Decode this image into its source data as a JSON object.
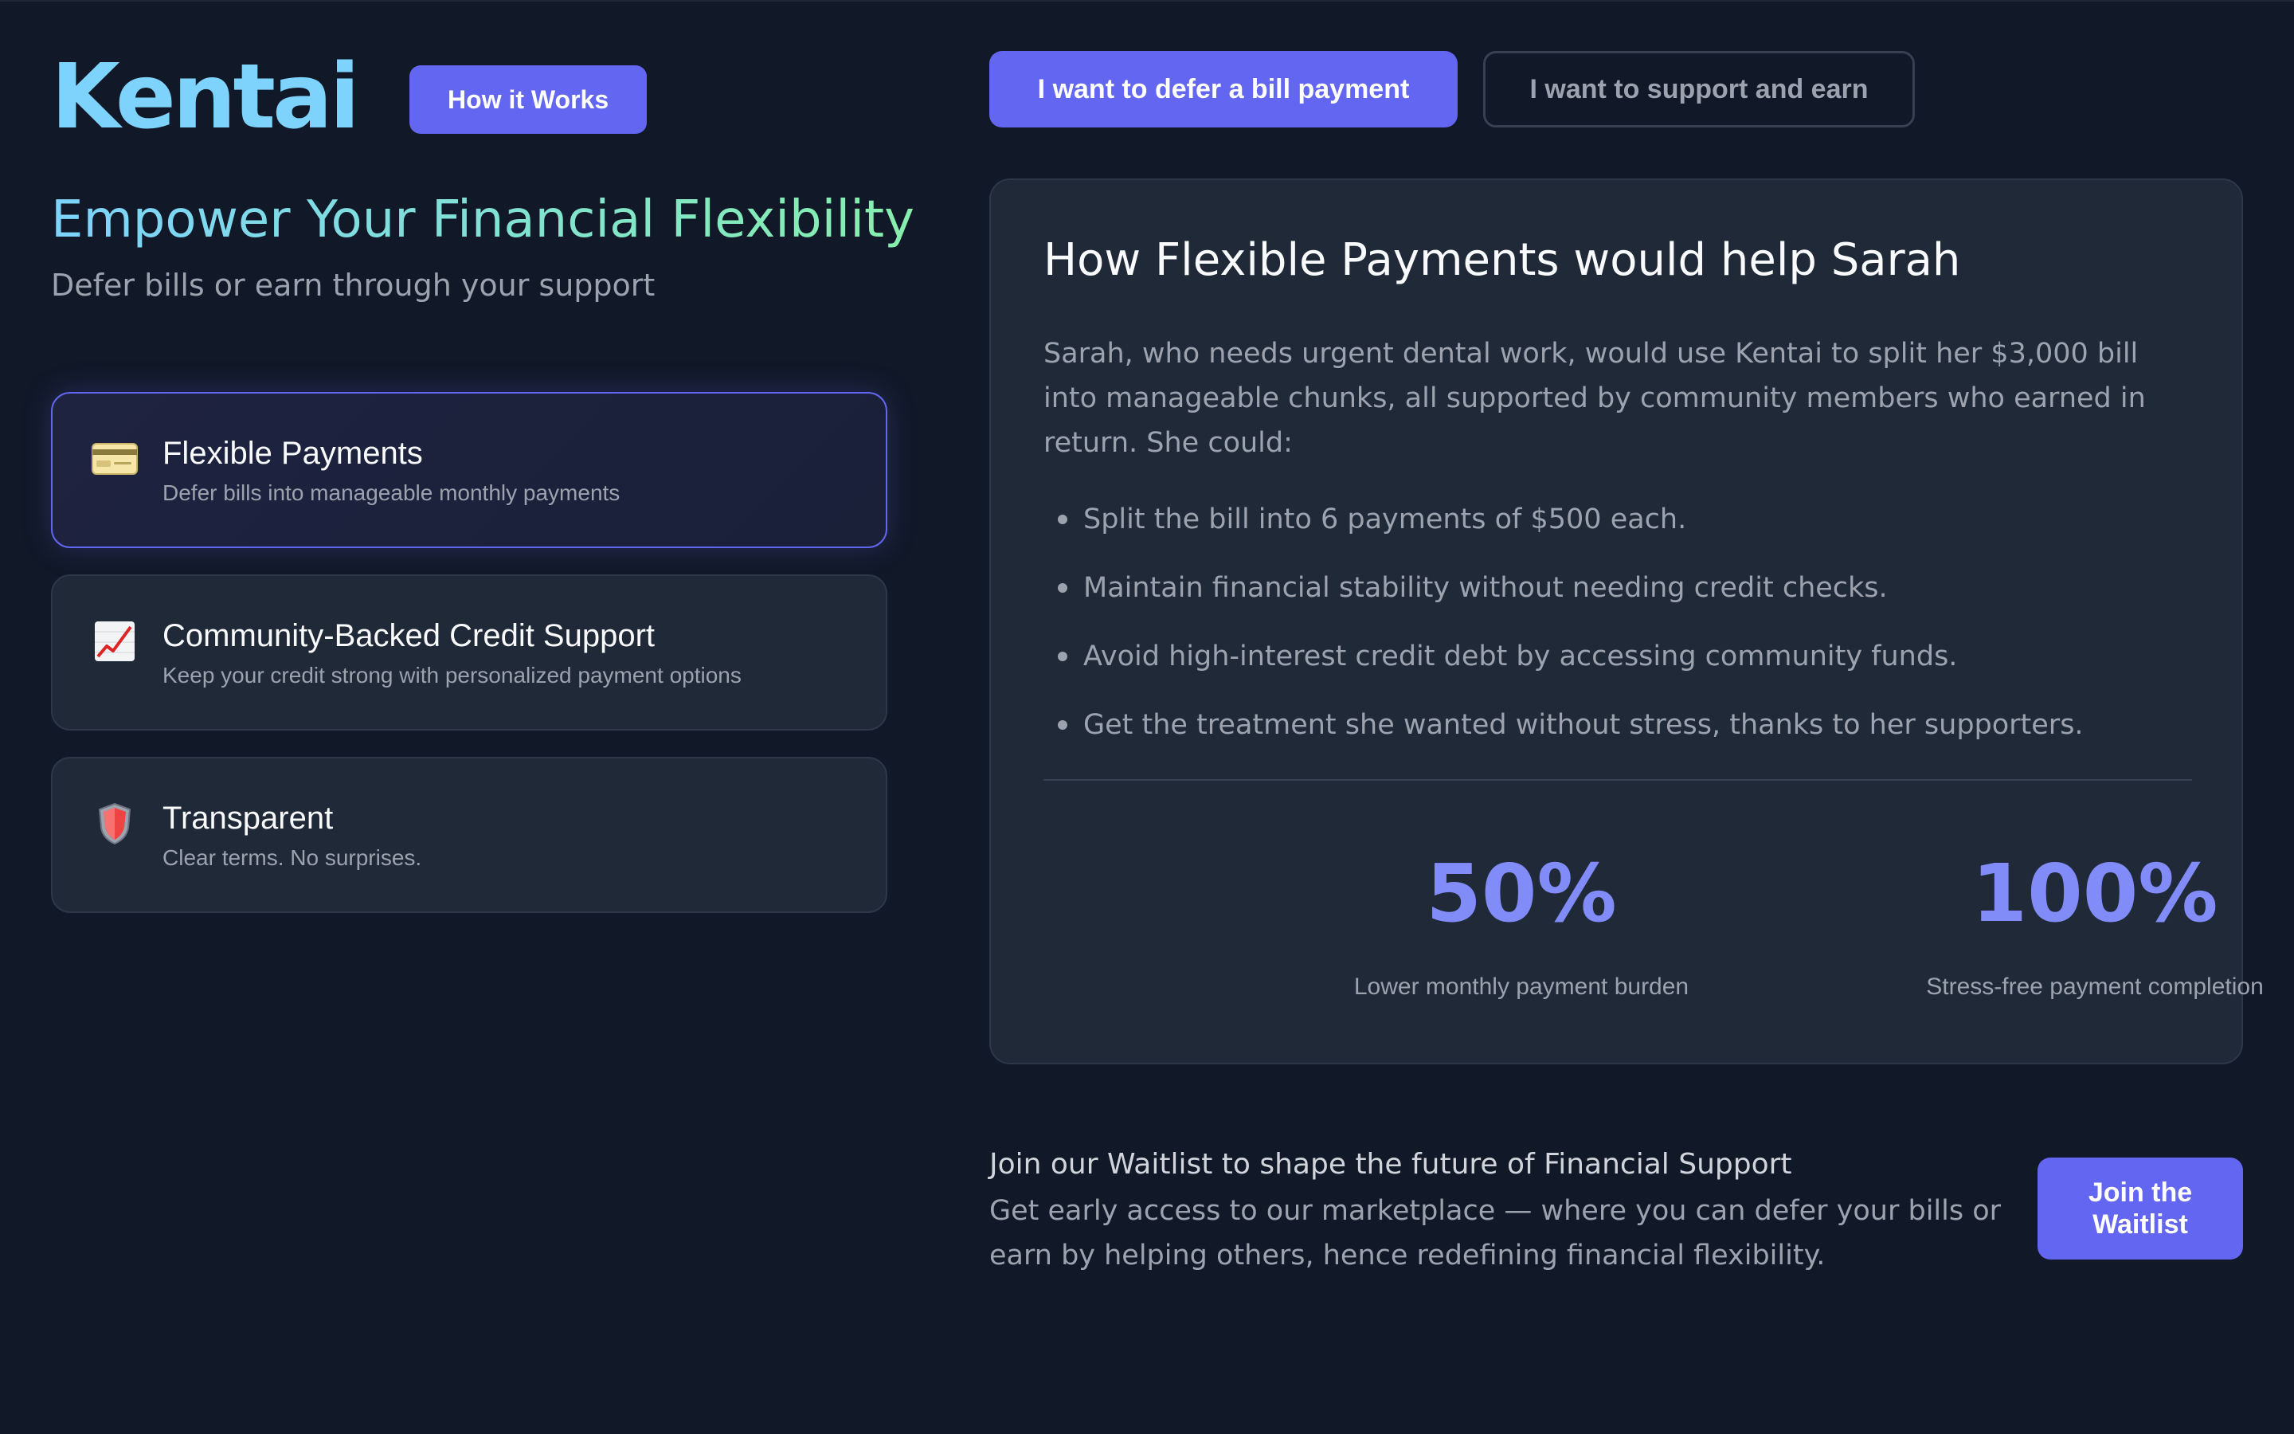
{
  "brand": {
    "logo": "Kentai",
    "how_it_works_label": "How it Works"
  },
  "hero": {
    "title": "Empower Your Financial Flexibility",
    "subtitle": "Defer bills or earn through your support"
  },
  "features": [
    {
      "icon": "credit-card-icon",
      "title": "Flexible Payments",
      "description": "Defer bills into manageable monthly payments",
      "active": true
    },
    {
      "icon": "chart-increasing-icon",
      "title": "Community-Backed Credit Support",
      "description": "Keep your credit strong with personalized payment options",
      "active": false
    },
    {
      "icon": "shield-icon",
      "title": "Transparent",
      "description": "Clear terms. No surprises.",
      "active": false
    }
  ],
  "tabs": {
    "defer_label": "I want to defer a bill payment",
    "support_label": "I want to support and earn",
    "selected": "defer"
  },
  "story": {
    "title": "How Flexible Payments would help Sarah",
    "body": "Sarah, who needs urgent dental work, would use Kentai to split her $3,000 bill into manageable chunks, all supported by community members who earned in return. She could:",
    "bullets": [
      "Split the bill into 6 payments of $500 each.",
      "Maintain financial stability without needing credit checks.",
      "Avoid high-interest credit debt by accessing community funds.",
      "Get the treatment she wanted without stress, thanks to her supporters."
    ],
    "stats": [
      {
        "value": "50%",
        "label": "Lower monthly payment burden"
      },
      {
        "value": "100%",
        "label": "Stress-free payment completion"
      }
    ]
  },
  "waitlist": {
    "title": "Join our Waitlist to shape the future of Financial Support",
    "description": "Get early access to our marketplace — where you can defer your bills or earn by helping others, hence redefining financial flexibility.",
    "button_label": "Join the Waitlist"
  },
  "colors": {
    "background": "#111827",
    "card": "#1f2937",
    "accent": "#6366f1",
    "stat": "#818cf8",
    "logo": "#7dd3fc",
    "gradient_end": "#86efac"
  }
}
